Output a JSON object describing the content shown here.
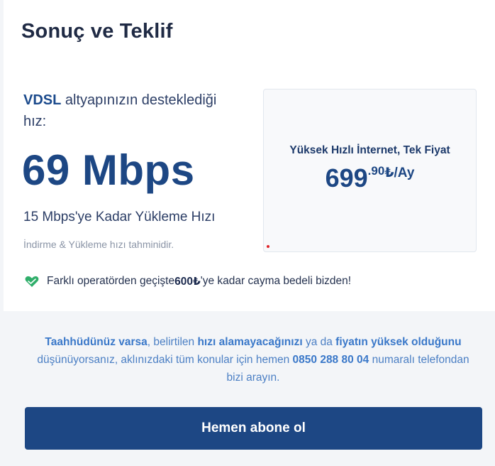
{
  "header": {
    "title": "Sonuç ve Teklif"
  },
  "result": {
    "infra_strong": "VDSL",
    "infra_text": " altyapınızın desteklediği hız:",
    "speed": "69 Mbps",
    "upload": "15 Mbps'ye Kadar Yükleme Hızı",
    "estimate_note": "İndirme & Yükleme hızı tahminidir."
  },
  "offer": {
    "title": "Yüksek Hızlı İnternet, Tek Fiyat",
    "price_main": "699",
    "price_cents": ".90",
    "price_unit": "₺/Ay"
  },
  "promo": {
    "icon": "heart-hands-icon",
    "text_before": "Farklı operatörden geçişte ",
    "amount": "600₺",
    "text_after": "'ye kadar cayma bedeli bizden!"
  },
  "notice": {
    "part1_bold": "Taahhüdünüz varsa",
    "part2": ", belirtilen ",
    "part3_bold": "hızı alamayacağınızı",
    "part4": " ya da ",
    "part5_bold": "fiyatın yüksek olduğunu",
    "part6": " düşünüyorsanız, aklınızdaki tüm konular için hemen ",
    "phone": "0850 288 80 04",
    "part7": " numaralı telefondan bizi arayın."
  },
  "cta": {
    "label": "Hemen abone ol"
  },
  "colors": {
    "primary": "#1d4784",
    "accent_blue": "#3a78c9",
    "promo_green": "#2fae6a"
  }
}
